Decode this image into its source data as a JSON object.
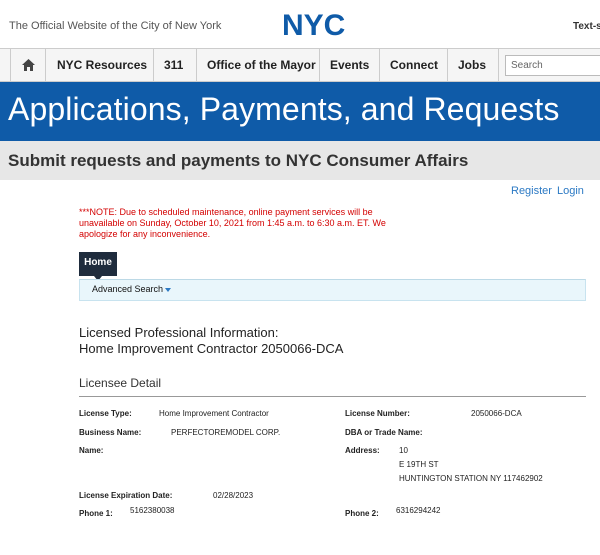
{
  "header": {
    "official_text": "The Official Website of the City of New York",
    "logo_text": "NYC",
    "text_size_label": "Text-s"
  },
  "nav": {
    "home_icon": "home-icon",
    "items": [
      {
        "label": "NYC Resources"
      },
      {
        "label": "311"
      },
      {
        "label": "Office of the Mayor"
      },
      {
        "label": "Events"
      },
      {
        "label": "Connect"
      },
      {
        "label": "Jobs"
      }
    ],
    "search_placeholder": "Search"
  },
  "banner": {
    "title": "Applications, Payments, and Requests",
    "subtitle": "Submit requests and payments to NYC Consumer Affairs"
  },
  "auth": {
    "register": "Register",
    "login": "Login"
  },
  "notice": "***NOTE: Due to scheduled maintenance, online payment services will be unavailable on Sunday, October 10, 2021 from 1:45 a.m. to 6:30 a.m. ET. We apologize for any inconvenience.",
  "tabs": {
    "home": "Home",
    "advanced_search": "Advanced Search"
  },
  "professional": {
    "line1": "Licensed Professional Information:",
    "line2": "Home Improvement Contractor 2050066-DCA"
  },
  "licensee": {
    "section_title": "Licensee Detail",
    "license_type_label": "License Type:",
    "license_type": "Home Improvement Contractor",
    "license_number_label": "License Number:",
    "license_number": "2050066-DCA",
    "business_name_label": "Business Name:",
    "business_name": "PERFECTOREMODEL CORP.",
    "dba_label": "DBA or Trade Name:",
    "name_label": "Name:",
    "address_label": "Address:",
    "address_line1": "10",
    "address_line2": "E 19TH ST",
    "address_line3": "HUNTINGTON STATION NY 117462902",
    "expiration_label": "License Expiration Date:",
    "expiration": "02/28/2023",
    "phone1_label": "Phone 1:",
    "phone1": "5162380038",
    "phone2_label": "Phone 2:",
    "phone2": "6316294242"
  },
  "colors": {
    "banner_blue": "#0f5ba8",
    "notice_red": "#d30000",
    "link_blue": "#2b79c4",
    "tab_dark": "#1f2c3d"
  }
}
